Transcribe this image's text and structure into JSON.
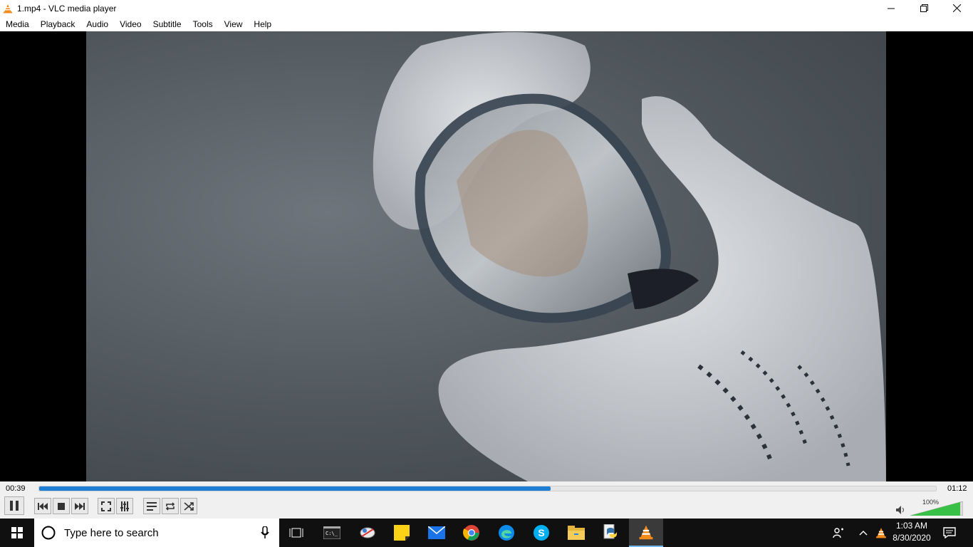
{
  "window": {
    "title": "1.mp4 - VLC media player"
  },
  "menu": [
    "Media",
    "Playback",
    "Audio",
    "Video",
    "Subtitle",
    "Tools",
    "View",
    "Help"
  ],
  "player": {
    "elapsed": "00:39",
    "total": "01:12",
    "progress": 0.57,
    "volume": "100%"
  },
  "taskbar": {
    "search_placeholder": "Type here to search",
    "time": "1:03 AM",
    "date": "8/30/2020"
  },
  "colors": {
    "accent": "#1d7ed6",
    "vlc_orange": "#f28b1b",
    "volume_green": "#39c046"
  },
  "icons": [
    "windows-logo-icon",
    "search-icon",
    "microphone-icon",
    "task-view-icon",
    "terminal-icon",
    "snip-icon",
    "sticky-notes-icon",
    "mail-icon",
    "chrome-icon",
    "edge-icon",
    "skype-icon",
    "file-explorer-icon",
    "python-icon",
    "vlc-icon",
    "people-icon",
    "chevron-up-icon",
    "notification-icon"
  ]
}
